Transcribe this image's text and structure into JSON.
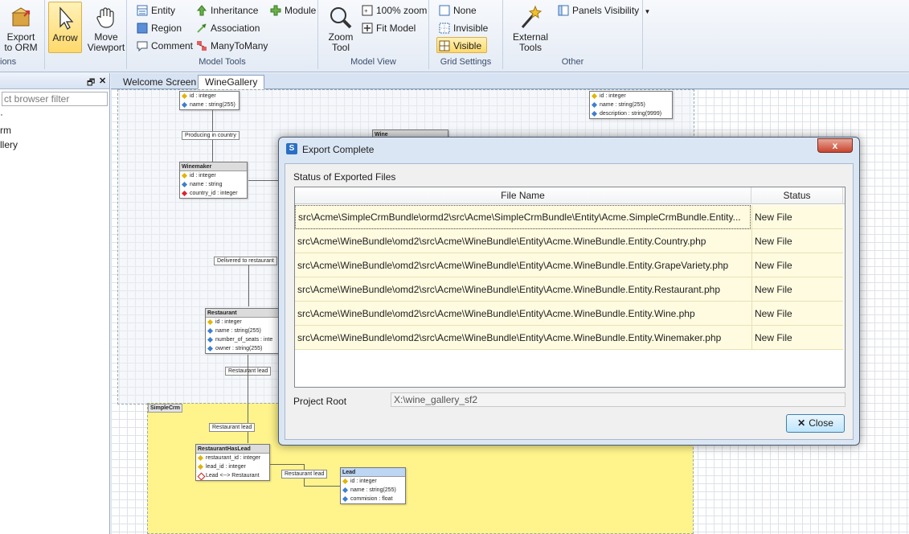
{
  "ribbon": {
    "export": {
      "label": "Export\nto ORM",
      "group": "ions"
    },
    "arrow": {
      "label": "Arrow"
    },
    "move_viewport": {
      "label": "Move\nViewport"
    },
    "model_tools": {
      "entity": "Entity",
      "region": "Region",
      "comment": "Comment",
      "inheritance": "Inheritance",
      "association": "Association",
      "many_to_many": "ManyToMany",
      "module": "Module",
      "group_label": "Model Tools"
    },
    "model_view": {
      "zoom_tool": "Zoom\nTool",
      "zoom100": "100% zoom",
      "fit_model": "Fit Model",
      "group_label": "Model View"
    },
    "grid_settings": {
      "none": "None",
      "invisible": "Invisible",
      "visible": "Visible",
      "group_label": "Grid Settings"
    },
    "other": {
      "external_tools": "External\nTools",
      "panels_visibility": "Panels Visibility",
      "group_label": "Other"
    }
  },
  "left_panel": {
    "filter_placeholder": "ct browser filter",
    "items": [
      "rm",
      "llery"
    ]
  },
  "tabs": [
    {
      "label": "Welcome Screen"
    },
    {
      "label": "WineGallery"
    }
  ],
  "diagram": {
    "top_entity_fields": [
      "id : integer",
      "name : string(255)"
    ],
    "top_right_fields": [
      "id : integer",
      "name : string(255)",
      "description : string(9999)"
    ],
    "producing_label": "Producing in country",
    "wine_header": "Wine",
    "winemaker": {
      "title": "Winemaker",
      "fields": [
        "id : integer",
        "name : string",
        "country_id : integer"
      ]
    },
    "delivered_label": "Delivered to restaurant",
    "restaurant": {
      "title": "Restaurant",
      "fields": [
        "id : integer",
        "name : string(255)",
        "number_of_seats : inte",
        "owner : string(255)"
      ]
    },
    "restaurant_lead_label": "Restaurant lead",
    "simplecrm_region": "SimpleCrm",
    "restaurant_lead_label2": "Restaurant lead",
    "rhl": {
      "title": "RestaurantHasLead",
      "fields": [
        "restaurant_id : integer",
        "lead_id : integer",
        "Lead <--> Restaurant"
      ]
    },
    "restaurant_lead_label3": "Restaurant lead",
    "lead": {
      "title": "Lead",
      "fields": [
        "id : integer",
        "name : string(255)",
        "commision : float"
      ]
    }
  },
  "dialog": {
    "title": "Export Complete",
    "close_x": "x",
    "status_label": "Status of Exported Files",
    "columns": {
      "file_name": "File Name",
      "status": "Status"
    },
    "rows": [
      {
        "file": "src\\Acme\\SimpleCrmBundle\\ormd2\\src\\Acme\\SimpleCrmBundle\\Entity\\Acme.SimpleCrmBundle.Entity...",
        "status": "New File"
      },
      {
        "file": "src\\Acme\\WineBundle\\omd2\\src\\Acme\\WineBundle\\Entity\\Acme.WineBundle.Entity.Country.php",
        "status": "New File"
      },
      {
        "file": "src\\Acme\\WineBundle\\omd2\\src\\Acme\\WineBundle\\Entity\\Acme.WineBundle.Entity.GrapeVariety.php",
        "status": "New File"
      },
      {
        "file": "src\\Acme\\WineBundle\\omd2\\src\\Acme\\WineBundle\\Entity\\Acme.WineBundle.Entity.Restaurant.php",
        "status": "New File"
      },
      {
        "file": "src\\Acme\\WineBundle\\omd2\\src\\Acme\\WineBundle\\Entity\\Acme.WineBundle.Entity.Wine.php",
        "status": "New File"
      },
      {
        "file": "src\\Acme\\WineBundle\\omd2\\src\\Acme\\WineBundle\\Entity\\Acme.WineBundle.Entity.Winemaker.php",
        "status": "New File"
      }
    ],
    "project_root_label": "Project Root",
    "project_root_value": "X:\\wine_gallery_sf2",
    "close_button": "Close"
  }
}
